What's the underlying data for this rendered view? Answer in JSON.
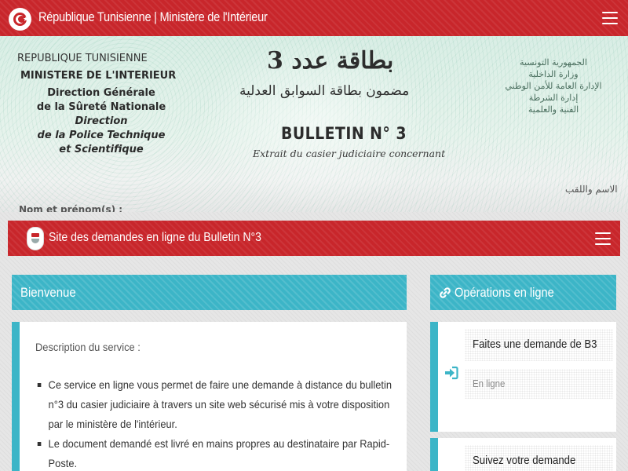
{
  "topbar": {
    "title": "République Tunisienne | Ministère de l'Intérieur",
    "colors": {
      "background": "#c8262b",
      "text": "#ffffff"
    }
  },
  "hero": {
    "fr_republique": "REPUBLIQUE TUNISIENNE",
    "fr_ministere": "MINISTERE DE L'INTERIEUR",
    "fr_direction_lines": [
      "Direction Générale",
      "de la Sûreté Nationale",
      "Direction",
      "de la Police Technique",
      "et Scientifique"
    ],
    "bulletin_label": "BULLETIN N° 3",
    "extrait_label": "Extrait du casier judiciaire concernant",
    "ar_title": "بطاقة عدد 3",
    "ar_subtitle": "مضمون بطاقة السوابق العدلية",
    "ar_right_lines": [
      "الجمهورية التونسية",
      "وزارة الداخلية",
      "الإدارة العامة للأمن الوطني",
      "إدارة الشرطة",
      "الفنية والعلمية"
    ],
    "ar_name_label": "الاسم واللقب",
    "fr_name_label": "Nom et prénom(s) :"
  },
  "service_bar": {
    "title": "Site des demandes en ligne du Bulletin N°3"
  },
  "welcome": {
    "header": "Bienvenue",
    "description_label": "Description du service :",
    "items": [
      "Ce service en ligne vous permet de faire une demande à distance du bulletin n°3 du casier judiciaire à travers un site web sécurisé mis à votre disposition par le ministère de l'intérieur.",
      "Le document demandé est livré en mains propres au destinataire par Rapid-Poste."
    ]
  },
  "operations": {
    "header": "Opérations en ligne",
    "header_icon": "link-icon",
    "cards": [
      {
        "title": "Faites une demande de B3",
        "subtitle": "En ligne",
        "icon": "sign-in-icon"
      },
      {
        "title": "Suivez votre demande",
        "subtitle": "",
        "icon": "sign-in-icon"
      }
    ]
  },
  "colors": {
    "accent_red": "#c8262b",
    "accent_teal": "#3cb5c7",
    "page_background": "#e6e6e6"
  }
}
